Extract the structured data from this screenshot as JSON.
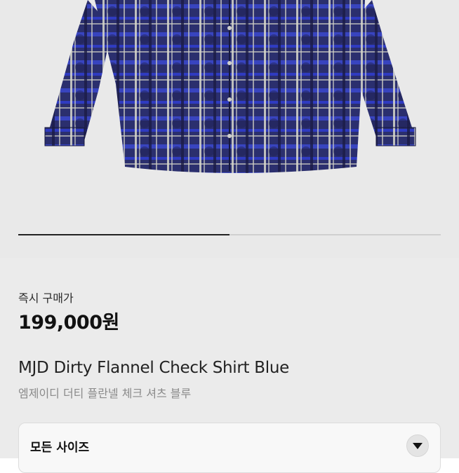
{
  "product": {
    "price_label": "즉시 구매가",
    "price": "199,000원",
    "name_en": "MJD Dirty Flannel Check Shirt Blue",
    "name_ko": "엠제이디 더티 플란넬 체크 셔츠 블루"
  },
  "gallery": {
    "progress_fraction": 0.5
  },
  "size_selector": {
    "label": "모든 사이즈",
    "icon": "chevron-down-icon"
  },
  "colors": {
    "shirt_navy": "#2b2f6e",
    "shirt_blue": "#2f3fd6",
    "gallery_bg": "#e9e9e9",
    "info_bg": "#ebebeb"
  }
}
